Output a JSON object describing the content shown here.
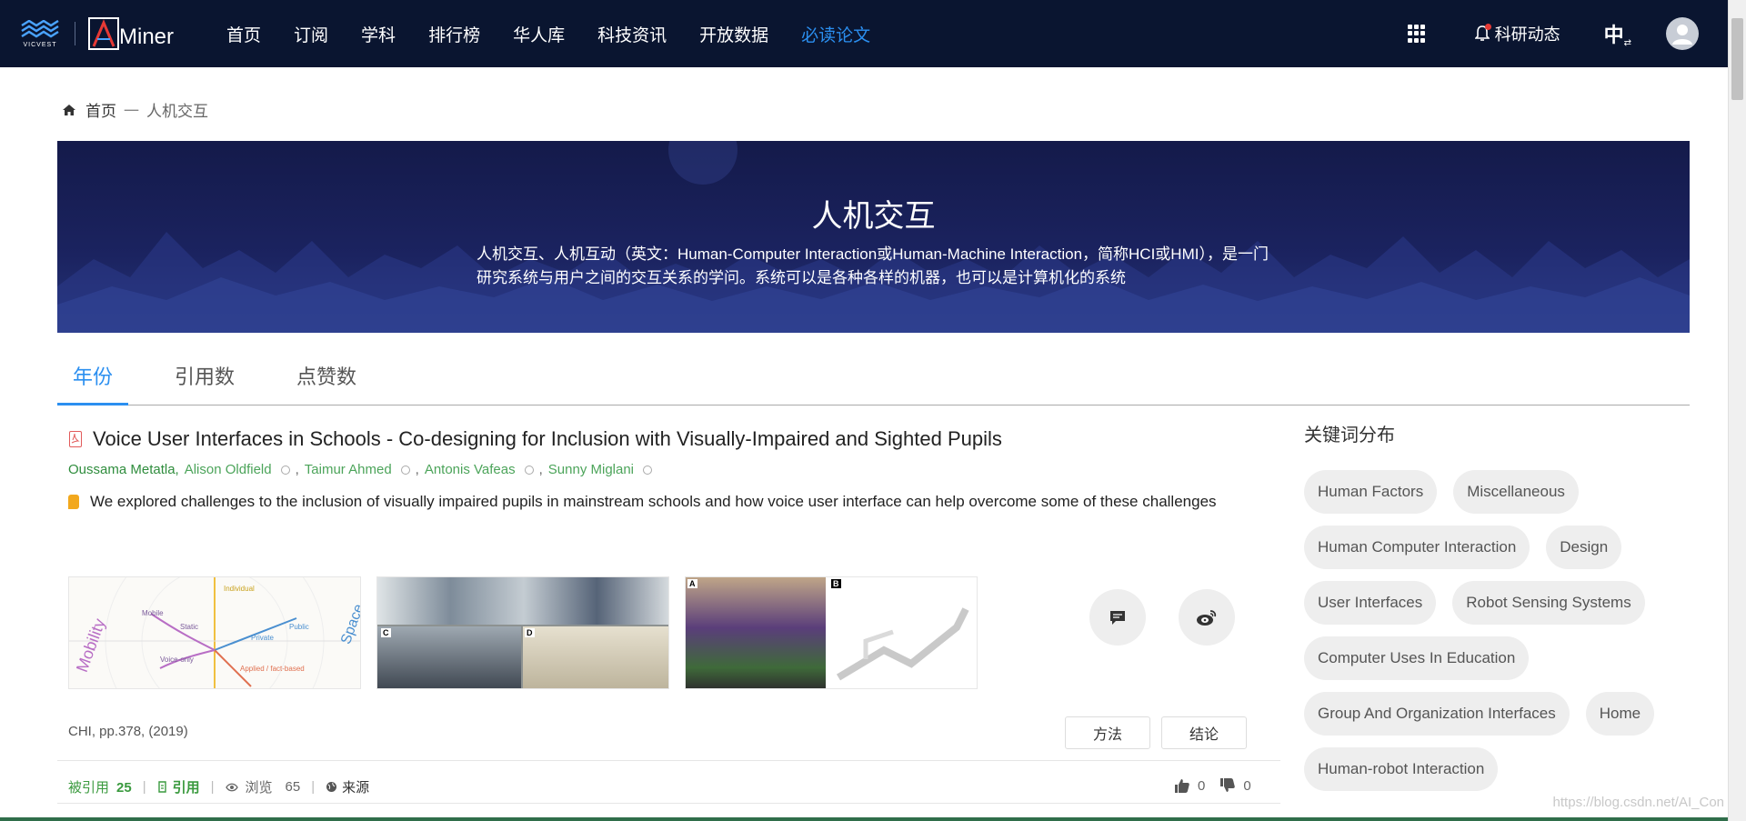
{
  "header": {
    "brand_small": "VICVEST",
    "brand": "Miner",
    "nav": [
      {
        "label": "首页"
      },
      {
        "label": "订阅"
      },
      {
        "label": "学科"
      },
      {
        "label": "排行榜"
      },
      {
        "label": "华人库"
      },
      {
        "label": "科技资讯"
      },
      {
        "label": "开放数据"
      },
      {
        "label": "必读论文"
      }
    ],
    "active_nav": "必读论文",
    "news_label": "科研动态",
    "lang_label": "中"
  },
  "breadcrumb": {
    "home": "首页",
    "separator": "一",
    "current": "人机交互"
  },
  "banner": {
    "title": "人机交互",
    "description": "人机交互、人机互动（英文：Human-Computer Interaction或Human-Machine Interaction，简称HCI或HMI），是一门研究系统与用户之间的交互关系的学问。系统可以是各种各样的机器，也可以是计算机化的系统"
  },
  "tabs": [
    {
      "label": "年份"
    },
    {
      "label": "引用数"
    },
    {
      "label": "点赞数"
    }
  ],
  "paper": {
    "title": "Voice User Interfaces in Schools - Co-designing for Inclusion with Visually-Impaired and Sighted Pupils",
    "authors": [
      "Oussama Metatla,",
      "Alison Oldfield",
      ",",
      "Taimur Ahmed",
      ",",
      "Antonis Vafeas",
      ",",
      "Sunny Miglani"
    ],
    "abstract": "We explored challenges to the inclusion of visually impaired pupils in mainstream schools and how voice user interface can help overcome some of these challenges",
    "figure_labels": {
      "fig1": [
        "Mobility",
        "Mobile",
        "Static",
        "Individual",
        "Public",
        "Private",
        "Voice-only",
        "Applied / fact-based",
        "Space"
      ],
      "fig2": [
        "C",
        "D"
      ],
      "fig3": [
        "A",
        "B"
      ]
    },
    "venue": "CHI, pp.378, (2019)",
    "method_label": "方法",
    "conclusion_label": "结论",
    "cited_label": "被引用",
    "cited_count": "25",
    "cite_label": "引用",
    "views_label": "浏览",
    "views_count": "65",
    "source_label": "来源",
    "likes": "0",
    "dislikes": "0"
  },
  "keywords": {
    "title": "关键词分布",
    "items": [
      "Human Factors",
      "Miscellaneous",
      "Human Computer Interaction",
      "Design",
      "User Interfaces",
      "Robot Sensing Systems",
      "Computer Uses In Education",
      "Group And Organization Interfaces",
      "Home",
      "Human-robot Interaction"
    ]
  },
  "watermark": "https://blog.csdn.net/AI_Con",
  "colors": {
    "header_bg": "#0a1530",
    "accent": "#2b8ff0",
    "author_green": "#4ca45a",
    "banner_bg": "#1b2360"
  }
}
